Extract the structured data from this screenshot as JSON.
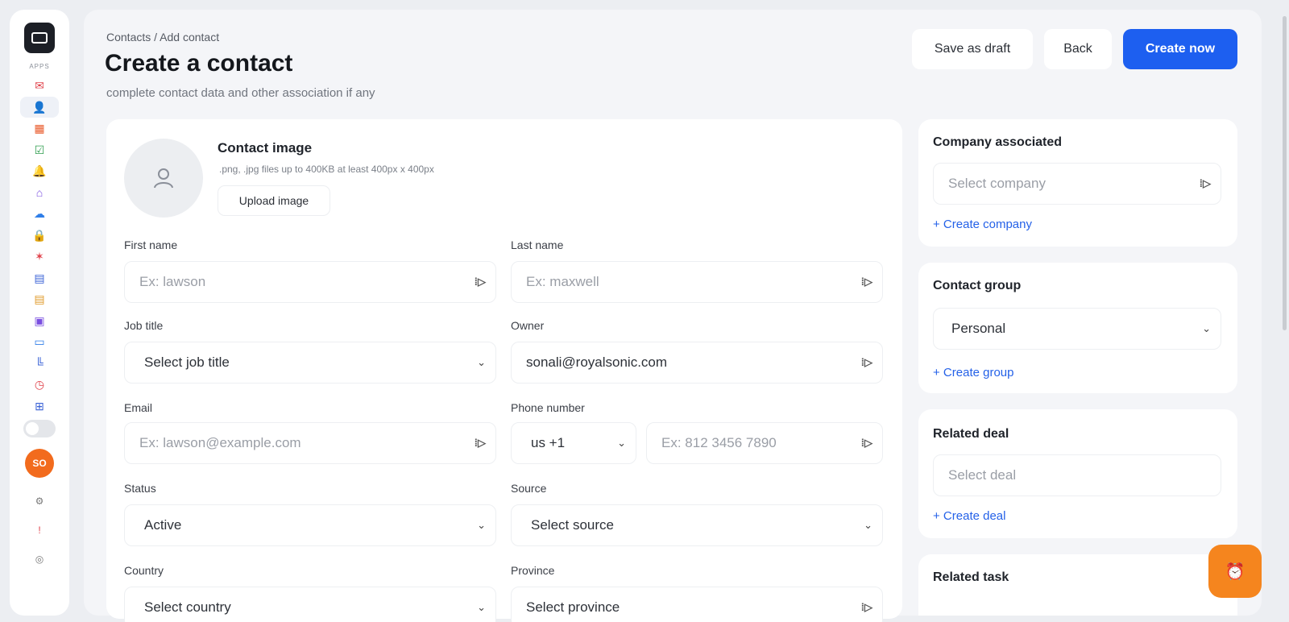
{
  "sidebar": {
    "apps_label": "APPS",
    "avatar_initials": "SO",
    "icons": [
      {
        "name": "mail-icon",
        "glyph": "✉",
        "color": "#e0424b"
      },
      {
        "name": "add-user-icon",
        "glyph": "👤",
        "color": "#3a62d6"
      },
      {
        "name": "calendar-icon",
        "glyph": "▦",
        "color": "#e95a2b"
      },
      {
        "name": "task-check-icon",
        "glyph": "☑",
        "color": "#2e9d4e"
      },
      {
        "name": "bell-icon",
        "glyph": "🔔",
        "color": "#f0a32a"
      },
      {
        "name": "home-icon",
        "glyph": "⌂",
        "color": "#7a4ee0"
      },
      {
        "name": "cloud-icon",
        "glyph": "☁",
        "color": "#2f7ee8"
      },
      {
        "name": "lock-icon",
        "glyph": "🔒",
        "color": "#4aa43d"
      },
      {
        "name": "users-icon",
        "glyph": "✶",
        "color": "#e0424b"
      },
      {
        "name": "document-icon",
        "glyph": "▤",
        "color": "#3a62d6"
      },
      {
        "name": "invoice-icon",
        "glyph": "▤",
        "color": "#e09a2b"
      },
      {
        "name": "image-icon",
        "glyph": "▣",
        "color": "#7a4ee0"
      },
      {
        "name": "video-icon",
        "glyph": "▭",
        "color": "#2f7ee8"
      },
      {
        "name": "chart-icon",
        "glyph": "╚",
        "color": "#3a62d6"
      },
      {
        "name": "timer-icon",
        "glyph": "◷",
        "color": "#e0424b"
      },
      {
        "name": "grid-icon",
        "glyph": "⊞",
        "color": "#3a62d6"
      }
    ]
  },
  "header": {
    "breadcrumb": "Contacts / Add contact",
    "title": "Create a contact",
    "subtitle": "complete contact data and other association if any",
    "save_draft_label": "Save as draft",
    "back_label": "Back",
    "create_label": "Create now"
  },
  "contact_image": {
    "title": "Contact image",
    "hint": ".png, .jpg files up to 400KB at least 400px x 400px",
    "upload_label": "Upload image"
  },
  "form": {
    "first_name": {
      "label": "First name",
      "placeholder": "Ex: lawson"
    },
    "last_name": {
      "label": "Last name",
      "placeholder": "Ex: maxwell"
    },
    "job_title": {
      "label": "Job title",
      "value": "Select job title"
    },
    "owner": {
      "label": "Owner",
      "value": "sonali@royalsonic.com"
    },
    "email": {
      "label": "Email",
      "placeholder": "Ex: lawson@example.com"
    },
    "phone": {
      "label": "Phone number",
      "country_code": "us +1",
      "placeholder": "Ex: 812 3456 7890"
    },
    "status": {
      "label": "Status",
      "value": "Active"
    },
    "source": {
      "label": "Source",
      "value": "Select source"
    },
    "country": {
      "label": "Country",
      "value": "Select country"
    },
    "province": {
      "label": "Province",
      "value": "Select province"
    }
  },
  "right": {
    "company": {
      "title": "Company associated",
      "placeholder": "Select company",
      "link": "+ Create company"
    },
    "group": {
      "title": "Contact group",
      "value": "Personal",
      "link": "+ Create group"
    },
    "deal": {
      "title": "Related deal",
      "placeholder": "Select deal",
      "link": "+ Create deal"
    },
    "task": {
      "title": "Related task"
    }
  }
}
